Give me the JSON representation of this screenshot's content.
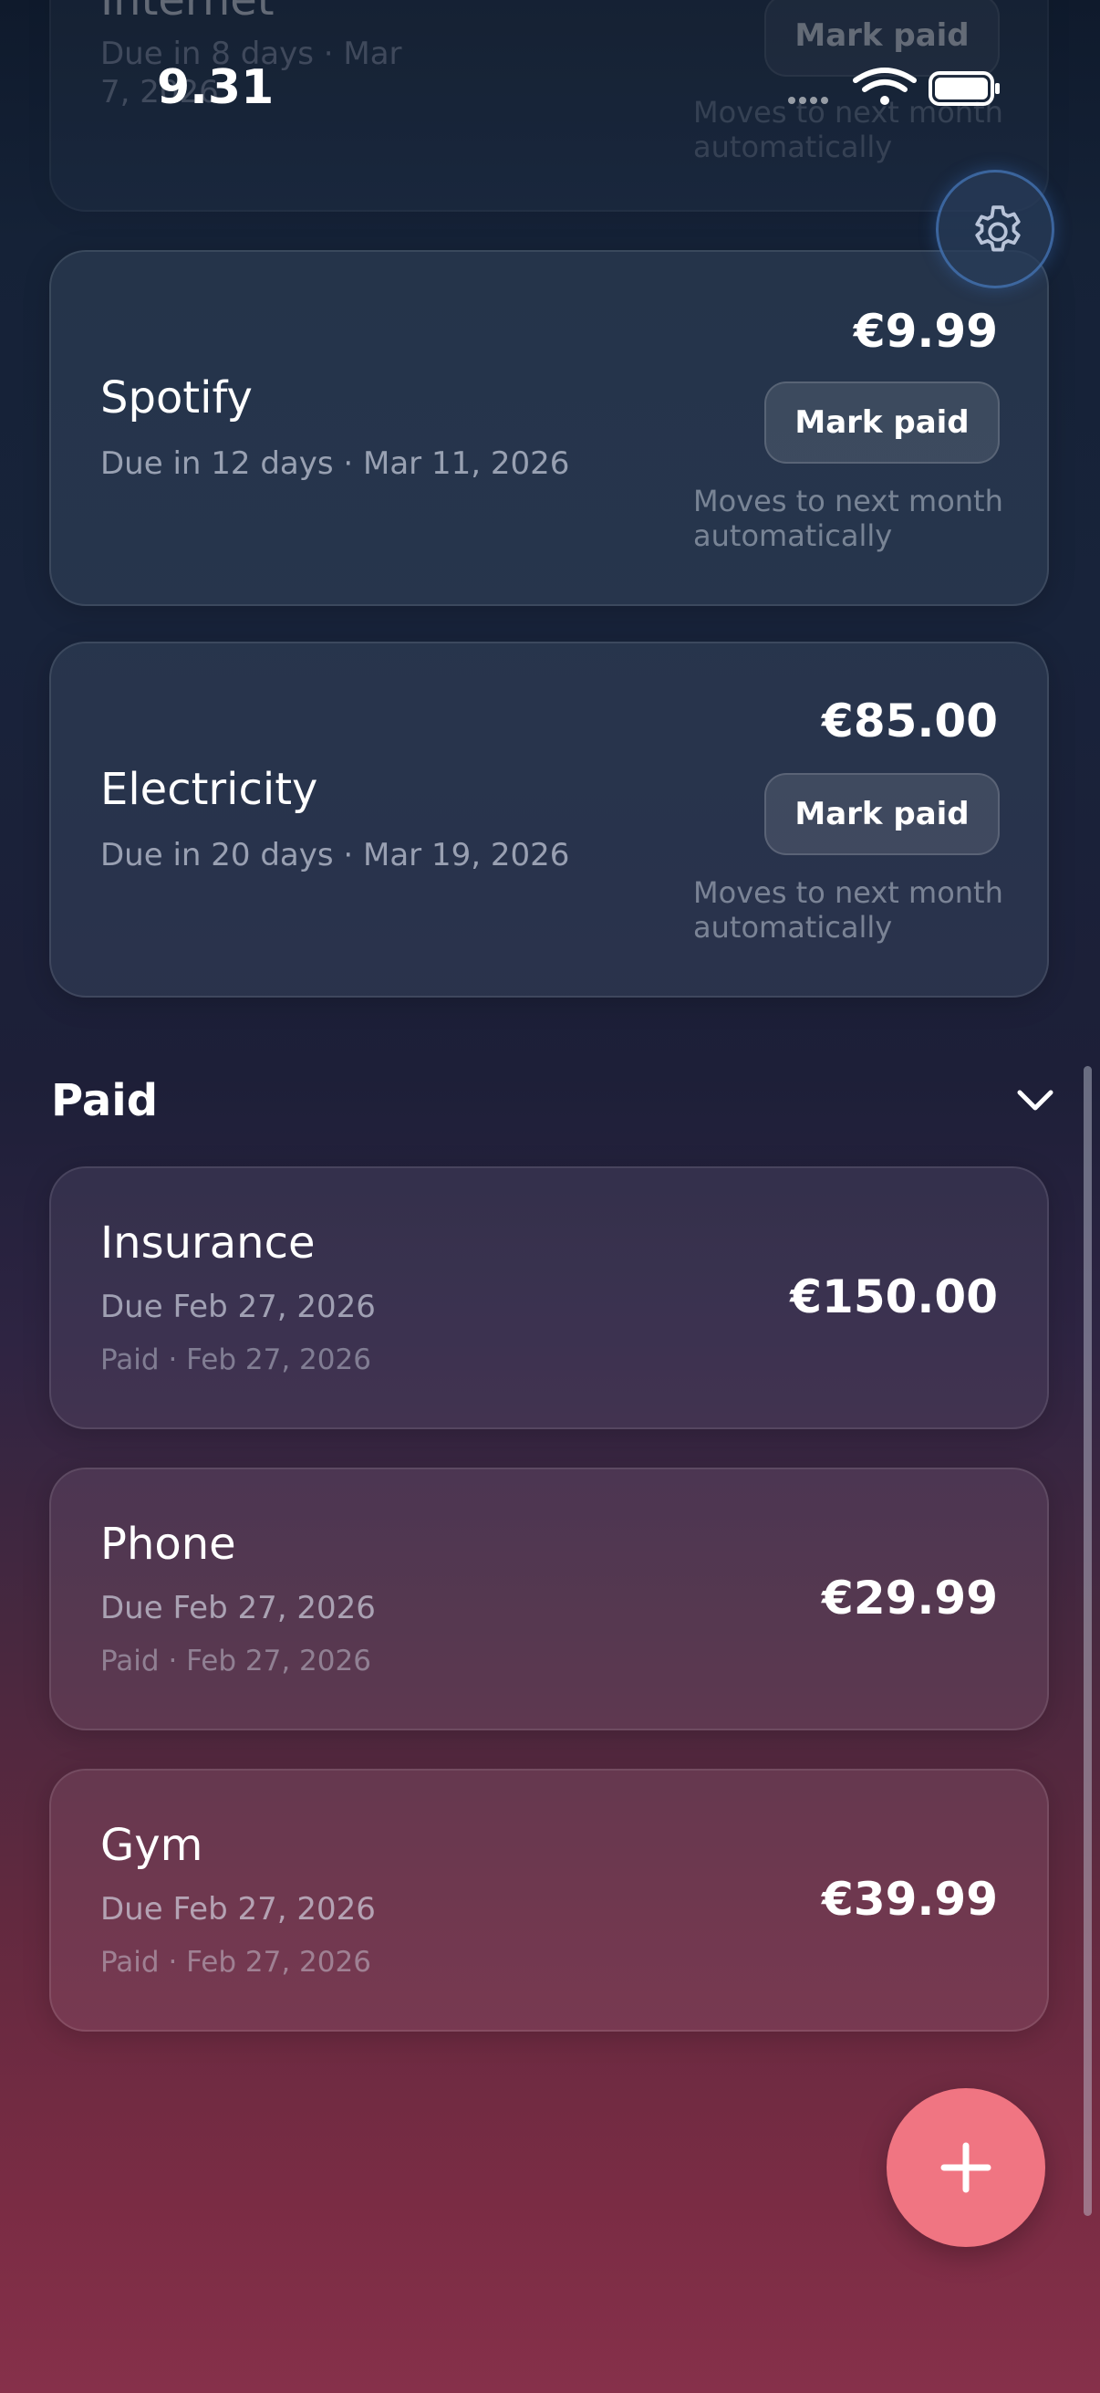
{
  "status_bar": {
    "time": "9.31",
    "icons": [
      "signal-dots-icon",
      "wifi-icon",
      "battery-icon"
    ]
  },
  "settings": {
    "icon": "gear-icon"
  },
  "upcoming": [
    {
      "name": "Internet",
      "due": "Due in 8 days · Mar 7, 2026",
      "amount": "",
      "button": "Mark paid",
      "note": "Moves to next month automatically"
    },
    {
      "name": "Spotify",
      "due": "Due in 12 days · Mar 11, 2026",
      "amount": "€9.99",
      "button": "Mark paid",
      "note": "Moves to next month automatically"
    },
    {
      "name": "Electricity",
      "due": "Due in 20 days · Mar 19, 2026",
      "amount": "€85.00",
      "button": "Mark paid",
      "note": "Moves to next month automatically"
    }
  ],
  "paid_section": {
    "title": "Paid",
    "chevron_icon": "chevron-down-icon",
    "items": [
      {
        "name": "Insurance",
        "due": "Due Feb 27, 2026",
        "paid": "Paid · Feb 27, 2026",
        "amount": "€150.00"
      },
      {
        "name": "Phone",
        "due": "Due Feb 27, 2026",
        "paid": "Paid · Feb 27, 2026",
        "amount": "€29.99"
      },
      {
        "name": "Gym",
        "due": "Due Feb 27, 2026",
        "paid": "Paid · Feb 27, 2026",
        "amount": "€39.99"
      }
    ]
  },
  "fab": {
    "icon": "plus-icon"
  },
  "colors": {
    "fab": "#f07582",
    "accent_ring": "#508cdc"
  }
}
